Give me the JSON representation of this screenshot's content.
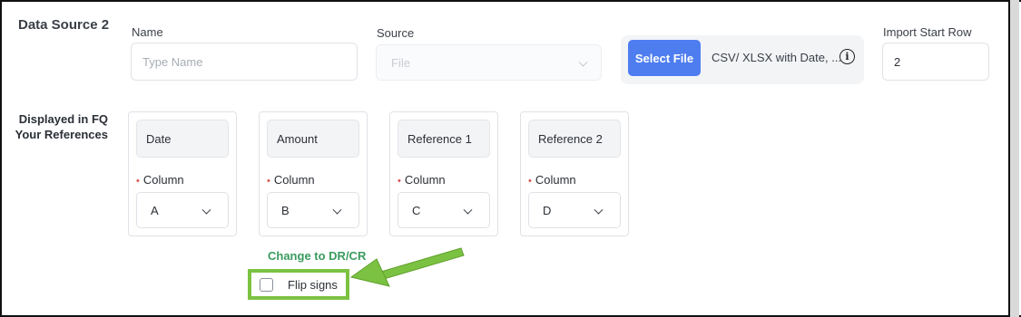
{
  "section": {
    "title": "Data Source 2"
  },
  "name_field": {
    "label": "Name",
    "placeholder": "Type Name"
  },
  "source_field": {
    "label": "Source",
    "placeholder": "File"
  },
  "file": {
    "button_label": "Select File",
    "hint": "CSV/ XLSX with Date, ...",
    "info_icon": "i"
  },
  "import_start_row": {
    "label": "Import Start Row",
    "value": "2"
  },
  "references": {
    "label_line1": "Displayed in FQ",
    "label_line2": "Your References",
    "column_label": "Column",
    "required_marker": "•",
    "cards": [
      {
        "name": "Date",
        "column": "A"
      },
      {
        "name": "Amount",
        "column": "B"
      },
      {
        "name": "Reference 1",
        "column": "C"
      },
      {
        "name": "Reference 2",
        "column": "D"
      }
    ]
  },
  "dr_cr": {
    "link_label": "Change to DR/CR",
    "flip_label": "Flip signs",
    "checked": false
  },
  "colors": {
    "accent": "#4e7df0",
    "highlight": "#7cc242",
    "link": "#3a9b5e",
    "required": "#d9534f"
  }
}
